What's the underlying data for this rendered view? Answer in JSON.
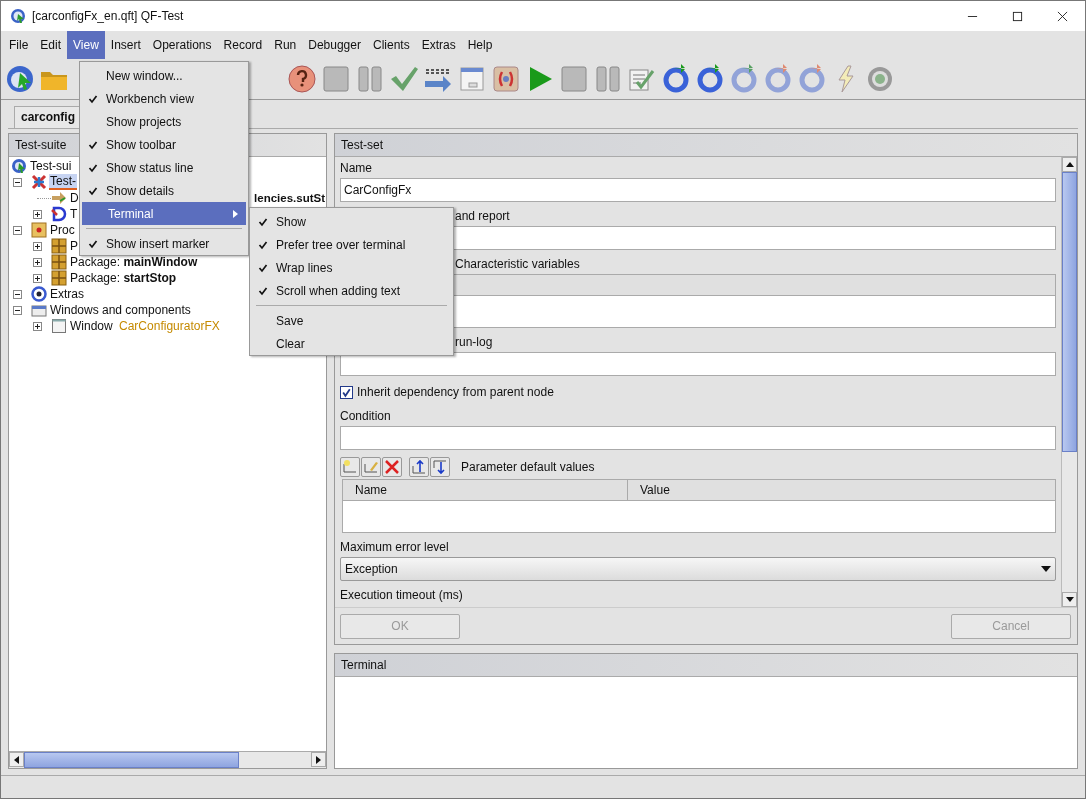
{
  "window": {
    "title": "[carconfigFx_en.qft] QF-Test"
  },
  "menubar": [
    {
      "label": "File",
      "selected": false
    },
    {
      "label": "Edit",
      "selected": false
    },
    {
      "label": "View",
      "selected": true
    },
    {
      "label": "Insert",
      "selected": false
    },
    {
      "label": "Operations",
      "selected": false
    },
    {
      "label": "Record",
      "selected": false
    },
    {
      "label": "Run",
      "selected": false
    },
    {
      "label": "Debugger",
      "selected": false
    },
    {
      "label": "Clients",
      "selected": false
    },
    {
      "label": "Extras",
      "selected": false
    },
    {
      "label": "Help",
      "selected": false
    }
  ],
  "view_menu": [
    {
      "kind": "item",
      "label": "New window...",
      "checked": false
    },
    {
      "kind": "item",
      "label": "Workbench view",
      "checked": true
    },
    {
      "kind": "item",
      "label": "Show projects",
      "checked": false
    },
    {
      "kind": "item",
      "label": "Show toolbar",
      "checked": true
    },
    {
      "kind": "item",
      "label": "Show status line",
      "checked": true
    },
    {
      "kind": "item",
      "label": "Show details",
      "checked": true
    },
    {
      "kind": "submenu",
      "label": "Terminal",
      "selected": true
    },
    {
      "kind": "separator"
    },
    {
      "kind": "item",
      "label": "Show insert marker",
      "checked": true
    }
  ],
  "terminal_menu": [
    {
      "kind": "item",
      "label": "Show",
      "checked": true
    },
    {
      "kind": "item",
      "label": "Prefer tree over terminal",
      "checked": true
    },
    {
      "kind": "item",
      "label": "Wrap lines",
      "checked": true
    },
    {
      "kind": "item",
      "label": "Scroll when adding text",
      "checked": true
    },
    {
      "kind": "separator"
    },
    {
      "kind": "item",
      "label": "Save",
      "checked": false
    },
    {
      "kind": "item",
      "label": "Clear",
      "checked": false
    }
  ],
  "document_tab": {
    "label": "carconfig"
  },
  "tree_panel": {
    "title": "Test-suite"
  },
  "tree": [
    {
      "kind": "suite",
      "label": "Test-sui",
      "selected": false,
      "children": [
        {
          "kind": "testset",
          "label": "Test-",
          "selected": true,
          "expanded": true,
          "children": [
            {
              "kind": "dependency",
              "label": "D",
              "tail": "lencies.sutSt",
              "selected": false
            },
            {
              "kind": "test",
              "label": "T",
              "selected": false,
              "expanded": false
            }
          ]
        },
        {
          "kind": "procedures",
          "label": "Proc",
          "selected": false,
          "expanded": true,
          "children": [
            {
              "kind": "package",
              "label": "P",
              "selected": false,
              "expanded": false
            },
            {
              "kind": "package",
              "label": "Package: **mainWindow**",
              "selected": false,
              "expanded": false
            },
            {
              "kind": "package",
              "label": "Package: **startStop**",
              "selected": false,
              "expanded": false
            }
          ]
        },
        {
          "kind": "extras",
          "label": "Extras",
          "selected": false,
          "expanded": true
        },
        {
          "kind": "windows",
          "label": "Windows and components",
          "selected": false,
          "expanded": true,
          "children": [
            {
              "kind": "window",
              "label": "Window",
              "accent": "CarConfiguratorFX",
              "selected": false,
              "expanded": false
            }
          ]
        }
      ]
    }
  ],
  "detail_panel": {
    "title": "Test-set",
    "fields": [
      {
        "kind": "text",
        "label": "Name",
        "value": "CarConfigFx"
      },
      {
        "kind": "text",
        "label": "and report",
        "covered": true
      },
      {
        "kind": "table",
        "label": "Characteristic variables",
        "covered": true
      },
      {
        "kind": "text",
        "label": "run-log",
        "covered": true
      },
      {
        "kind": "checkbox",
        "label": "Inherit dependency from parent node",
        "checked": true
      },
      {
        "kind": "text",
        "label": "Condition"
      },
      {
        "kind": "params",
        "label": "Parameter default values",
        "columns": [
          "Name",
          "Value"
        ]
      },
      {
        "kind": "combo",
        "label": "Maximum error level",
        "value": "Exception"
      },
      {
        "kind": "label",
        "label": "Execution timeout (ms)"
      }
    ],
    "buttons": [
      {
        "label": "OK",
        "disabled": true
      },
      {
        "label": "Cancel",
        "disabled": true
      }
    ]
  },
  "terminal_panel": {
    "title": "Terminal"
  }
}
